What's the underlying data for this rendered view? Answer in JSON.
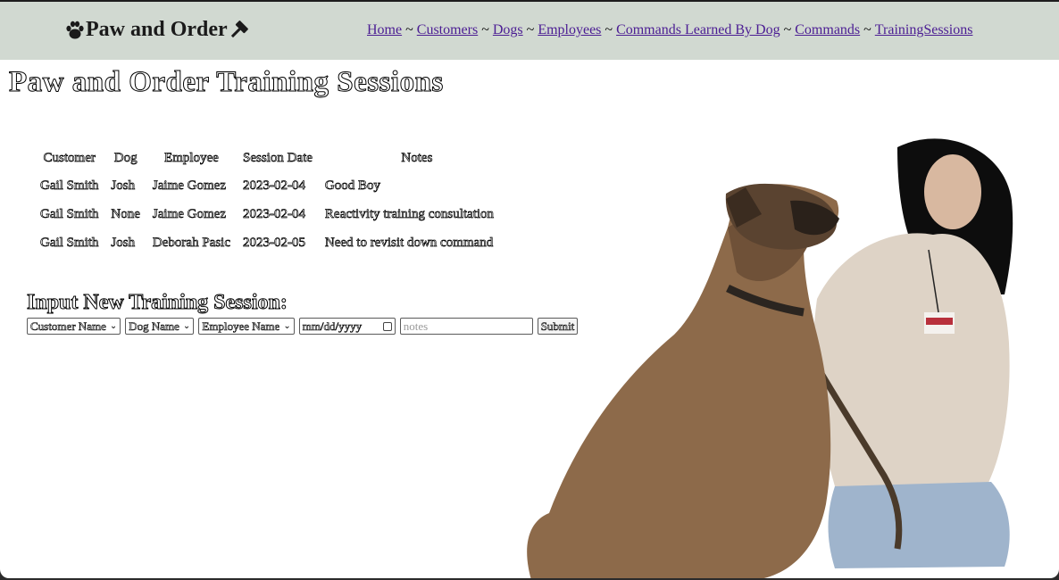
{
  "header": {
    "brand": "Paw and Order",
    "paw_icon": "paw-icon",
    "gavel_icon": "gavel-icon",
    "nav": [
      {
        "label": "Home"
      },
      {
        "label": "Customers"
      },
      {
        "label": "Dogs"
      },
      {
        "label": "Employees"
      },
      {
        "label": "Commands Learned By Dog"
      },
      {
        "label": "Commands"
      },
      {
        "label": "TrainingSessions"
      }
    ],
    "separator": "~",
    "bg_color": "#d1d9d1",
    "link_color": "#4b1d93"
  },
  "page_title": "Paw and Order Training Sessions",
  "table": {
    "headers": [
      "Customer",
      "Dog",
      "Employee",
      "Session Date",
      "Notes"
    ],
    "rows": [
      [
        "Gail Smith",
        "Josh",
        "Jaime Gomez",
        "2023-02-04",
        "Good Boy"
      ],
      [
        "Gail Smith",
        "None",
        "Jaime Gomez",
        "2023-02-04",
        "Reactivity training consultation"
      ],
      [
        "Gail Smith",
        "Josh",
        "Deborah Pasic",
        "2023-02-05",
        "Need to revisit down command"
      ]
    ]
  },
  "form": {
    "title": "Input New Training Session:",
    "customer_select": "Customer Name",
    "dog_select": "Dog Name",
    "employee_select": "Employee Name",
    "date_placeholder": "mm/dd/yyyy",
    "notes_placeholder": "notes",
    "submit_label": "Submit"
  }
}
